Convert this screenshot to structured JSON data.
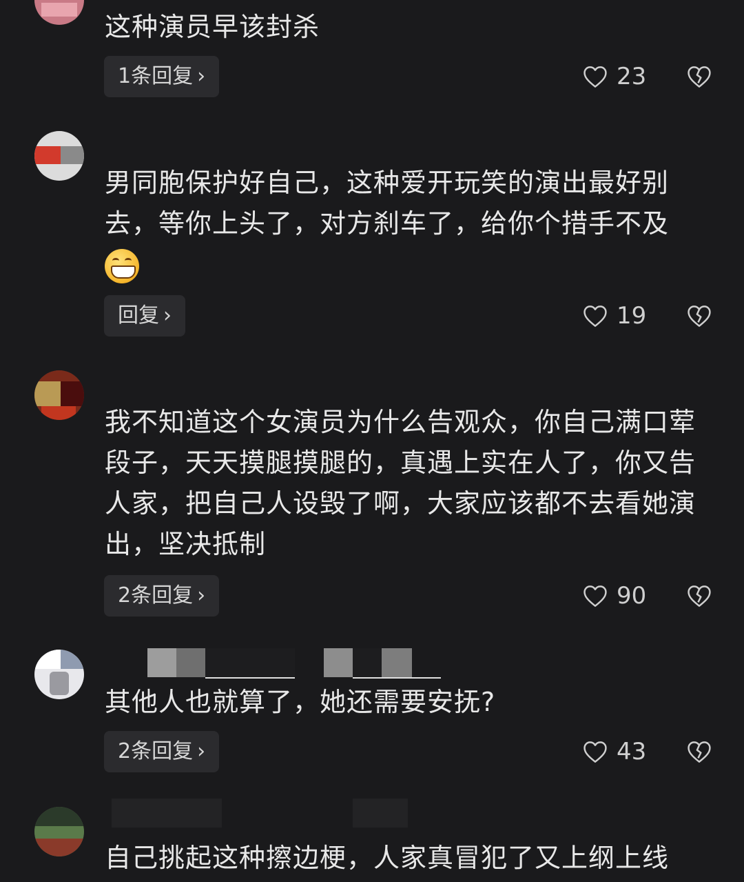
{
  "comments": [
    {
      "text": "这种演员早该封杀",
      "reply_label": "1条回复",
      "likes": "23"
    },
    {
      "text": "男同胞保护好自己，这种爱开玩笑的演出最好别去，等你上头了，对方刹车了，给你个措手不及",
      "emoji": "grinning-face-emoji",
      "reply_label": "回复",
      "likes": "19"
    },
    {
      "text": "我不知道这个女演员为什么告观众，你自己满口荤段子，天天摸腿摸腿的，真遇上实在人了，你又告人家，把自己人设毁了啊，大家应该都不去看她演出，坚决抵制",
      "reply_label": "2条回复",
      "likes": "90"
    },
    {
      "text": "其他人也就算了，她还需要安抚?",
      "reply_label": "2条回复",
      "likes": "43"
    },
    {
      "text": "自己挑起这种擦边梗，人家真冒犯了又上纲上线"
    }
  ],
  "icons": {
    "like": "heart-outline-icon",
    "dislike": "broken-heart-icon",
    "chevron": "chevron-right-icon"
  },
  "colors": {
    "background": "#1a1a1c",
    "text": "#e8e8e8",
    "reply_button_bg": "#2b2b2e"
  }
}
